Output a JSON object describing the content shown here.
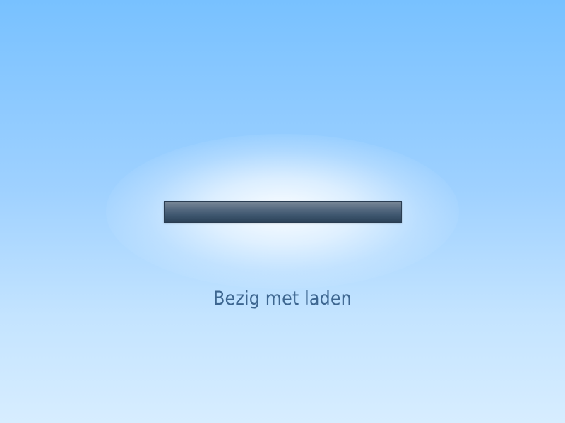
{
  "loader": {
    "status_text": "Bezig met laden",
    "progress_fraction": 0
  }
}
